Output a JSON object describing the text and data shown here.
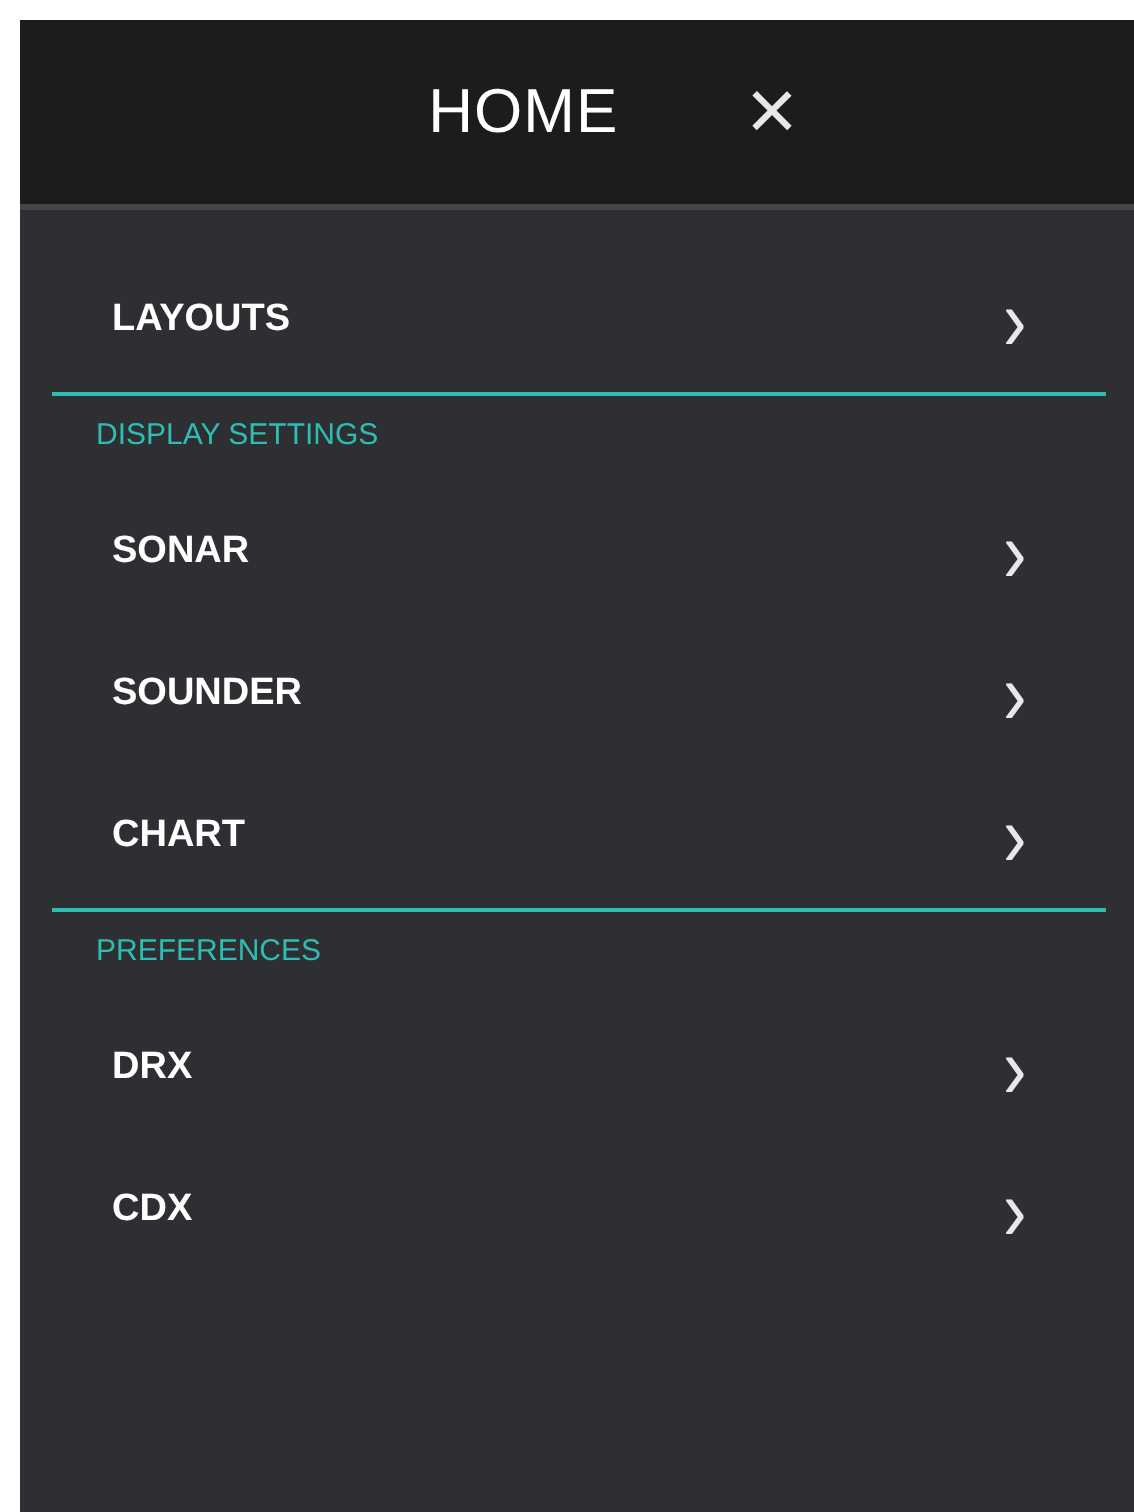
{
  "header": {
    "title": "HOME",
    "close": "×"
  },
  "menu": [
    {
      "kind": "item",
      "label": "LAYOUTS",
      "chevron": "›"
    },
    {
      "kind": "heading",
      "label": "DISPLAY SETTINGS"
    },
    {
      "kind": "item",
      "label": "SONAR",
      "chevron": "›"
    },
    {
      "kind": "item",
      "label": "SOUNDER",
      "chevron": "›"
    },
    {
      "kind": "item",
      "label": "CHART",
      "chevron": "›"
    },
    {
      "kind": "heading",
      "label": "PREFERENCES"
    },
    {
      "kind": "item",
      "label": "DRX",
      "chevron": "›"
    },
    {
      "kind": "item",
      "label": "CDX",
      "chevron": "›"
    }
  ]
}
